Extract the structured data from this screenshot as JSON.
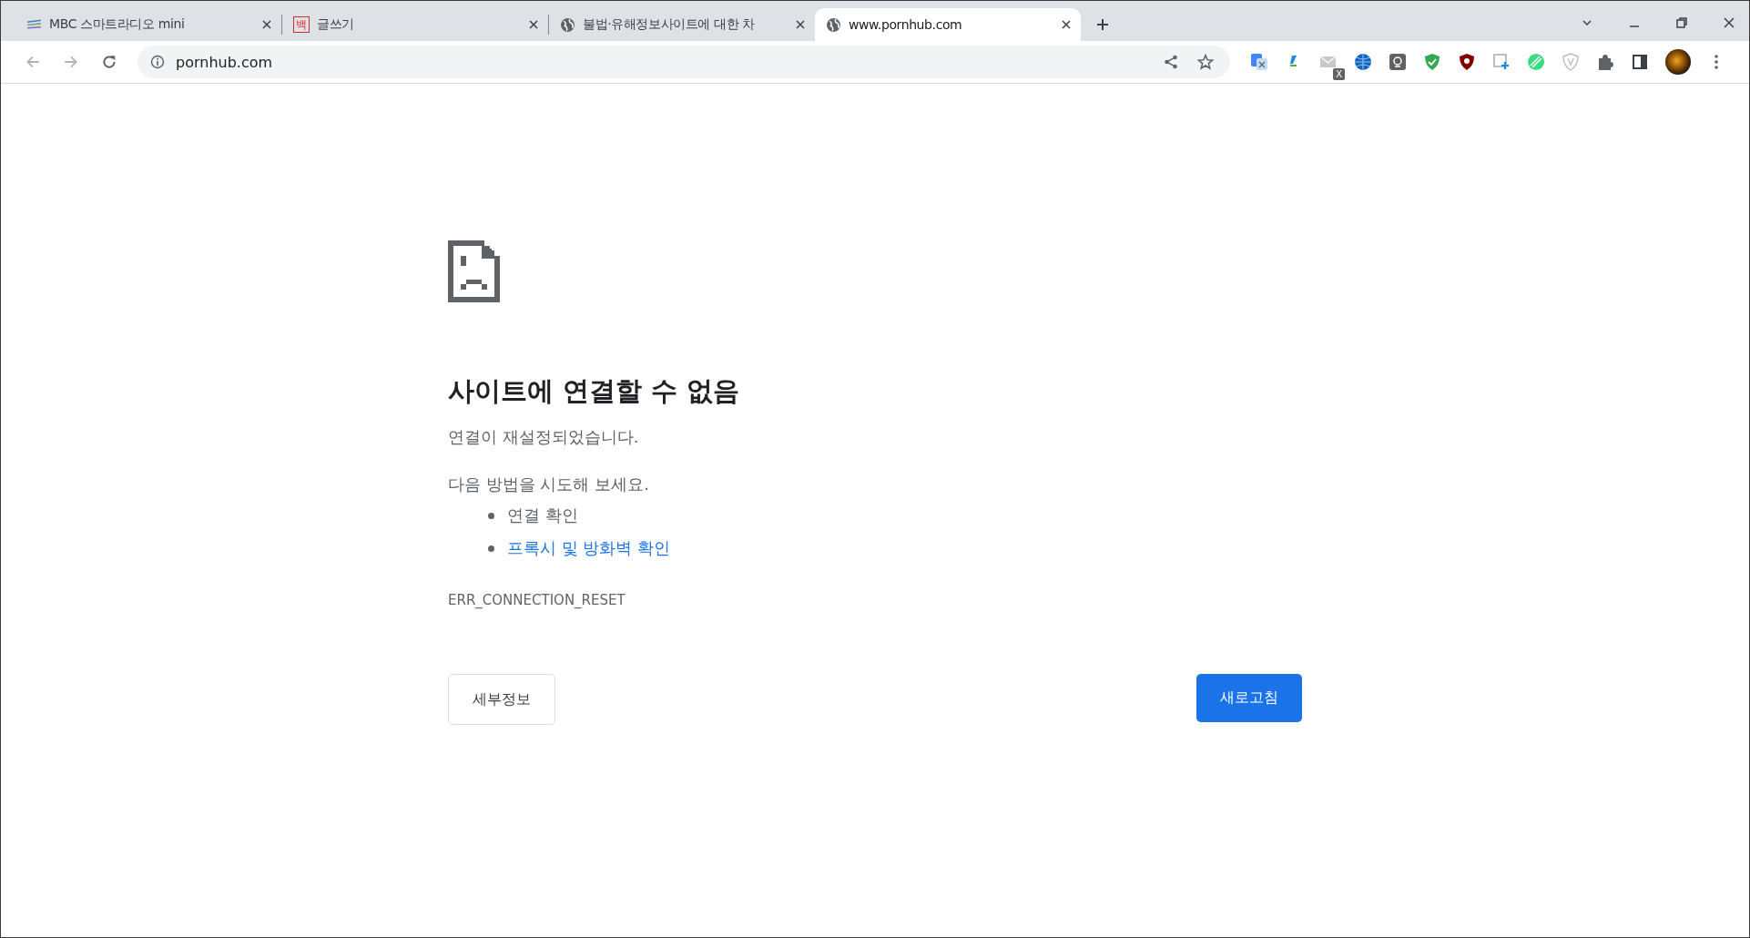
{
  "tabs": [
    {
      "title": "MBC 스마트라디오 mini",
      "kind": "lines",
      "selected": false
    },
    {
      "title": "글쓰기",
      "kind": "letter",
      "favicon_text": "백",
      "selected": false
    },
    {
      "title": "불법·유해정보사이트에 대한 차",
      "kind": "globe",
      "selected": false
    },
    {
      "title": "www.pornhub.com",
      "kind": "globe",
      "selected": true
    }
  ],
  "address_bar": {
    "url": "pornhub.com"
  },
  "extension_badge": "X",
  "error_page": {
    "heading": "사이트에 연결할 수 없음",
    "message": "연결이 재설정되었습니다.",
    "suggestion_intro": "다음 방법을 시도해 보세요.",
    "suggestions": [
      {
        "text": "연결 확인",
        "kind": "text"
      },
      {
        "text": "프록시 및 방화벽 확인",
        "kind": "link"
      }
    ],
    "error_code": "ERR_CONNECTION_RESET",
    "details_button": "세부정보",
    "reload_button": "새로고침"
  }
}
